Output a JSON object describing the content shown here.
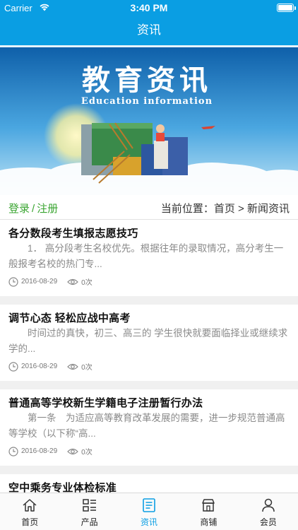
{
  "status_bar": {
    "carrier": "Carrier",
    "time": "3:40 PM",
    "battery_level": 1.0
  },
  "navbar": {
    "title": "资讯"
  },
  "banner": {
    "title": "教育资讯",
    "subtitle": "Education information"
  },
  "crumb_bar": {
    "login": "登录",
    "separator": "/",
    "register": "注册",
    "breadcrumb": "当前位置：首页 > 新闻资讯"
  },
  "articles": [
    {
      "title": "各分数段考生填报志愿技巧",
      "summary": "1． 高分段考生名校优先。根据往年的录取情况，高分考生一般报考名校的热门专...",
      "date": "2016-08-29",
      "views": "0次"
    },
    {
      "title": "调节心态 轻松应战中高考",
      "summary": "时间过的真快，初三、高三的 学生很快就要面临择业或继续求学的...",
      "date": "2016-08-29",
      "views": "0次"
    },
    {
      "title": "普通高等学校新生学籍电子注册暂行办法",
      "summary": "第一条　为适应高等教育改革发展的需要，进一步规范普通高等学校（以下称“高...",
      "date": "2016-08-29",
      "views": "0次"
    },
    {
      "title": "空中乘务专业体检标准"
    }
  ],
  "tab_bar": {
    "items": [
      {
        "label": "首页",
        "icon": "home-icon",
        "active": false
      },
      {
        "label": "产品",
        "icon": "grid-list-icon",
        "active": false
      },
      {
        "label": "资讯",
        "icon": "news-icon",
        "active": true
      },
      {
        "label": "商铺",
        "icon": "shop-icon",
        "active": false
      },
      {
        "label": "会员",
        "icon": "person-icon",
        "active": false
      }
    ]
  },
  "colors": {
    "primary": "#0a9ee3",
    "login_green": "#3aa531",
    "summary_gray": "#8a8a8a"
  }
}
